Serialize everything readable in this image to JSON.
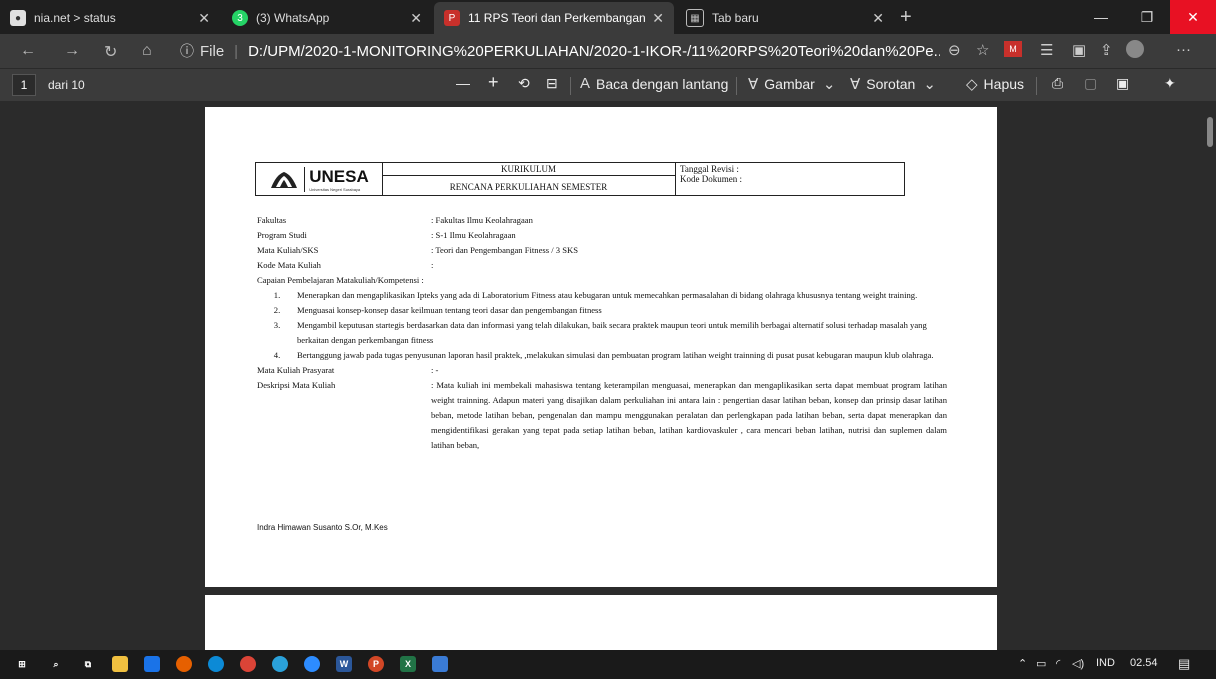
{
  "tabs": [
    {
      "label": "nia.net > status",
      "icon": "site-icon"
    },
    {
      "label": "(3) WhatsApp",
      "icon": "whatsapp-icon"
    },
    {
      "label": "11 RPS Teori dan Perkembangan",
      "icon": "pdf-icon"
    },
    {
      "label": "Tab baru",
      "icon": "newtab-page-icon"
    }
  ],
  "address": {
    "info": "ⓘ",
    "scheme": "File",
    "url": "D:/UPM/2020-1-MONITORING%20PERKULIAHAN/2020-1-IKOR-/11%20RPS%20Teori%20dan%20Pe..."
  },
  "pdf_toolbar": {
    "page": "1",
    "of": "dari 10",
    "read_aloud": "Baca dengan lantang",
    "draw": "Gambar",
    "highlight": "Sorotan",
    "erase": "Hapus"
  },
  "doc": {
    "brand": "UNESA",
    "brand_sub": "Universitas Negeri Surabaya",
    "kurikulum": "KURIKULUM",
    "rps": "RENCANA PERKULIAHAN SEMESTER",
    "tanggal": "Tanggal Revisi   :",
    "kode_dok": "Kode Dokumen   :",
    "fields": [
      {
        "k": "Fakultas",
        "v": ": Fakultas Ilmu Keolahragaan"
      },
      {
        "k": "Program Studi",
        "v": ": S-1 Ilmu Keolahragaan"
      },
      {
        "k": "Mata Kuliah/SKS",
        "v": ": Teori dan Pengembangan Fitness / 3 SKS"
      },
      {
        "k": "Kode Mata Kuliah",
        "v": ":"
      }
    ],
    "capaian": "Capaian Pembelajaran Matakuliah/Kompetensi      :",
    "items": [
      {
        "n": "1.",
        "t": "Menerapkan dan mengaplikasikan Ipteks yang ada di Laboratorium Fitness atau kebugaran untuk memecahkan permasalahan di bidang olahraga khususnya tentang weight training."
      },
      {
        "n": "2.",
        "t": "Menguasai konsep-konsep dasar keilmuan tentang teori dasar dan pengembangan fitness"
      },
      {
        "n": "3.",
        "t": "Mengambil  keputusan  startegis berdasarkan data dan informasi yang telah dilakukan, baik secara praktek maupun teori untuk memilih berbagai alternatif solusi terhadap masalah yang berkaitan dengan perkembangan fitness"
      },
      {
        "n": "4.",
        "t": "Bertanggung jawab pada tugas penyusunan laporan hasil praktek, ,melakukan simulasi dan pembuatan program latihan weight trainning di pusat pusat kebugaran maupun klub olahraga."
      }
    ],
    "prasyarat_k": "Mata Kuliah Prasyarat",
    "prasyarat_v": ": -",
    "deskripsi_k": "Deskripsi Mata Kuliah",
    "deskripsi_v": ": Mata kuliah  ini membekali  mahasiswa tentang  keterampilan menguasai, menerapkan dan mengaplikasikan serta dapat membuat program latihan weight trainning. Adapun materi yang disajikan dalam perkuliahan ini antara lain : pengertian dasar latihan beban, konsep dan prinsip dasar latihan beban, metode latihan beban, pengenalan dan mampu menggunakan peralatan dan perlengkapan  pada latihan beban, serta dapat menerapkan dan mengidentifikasi gerakan yang tepat pada setiap latihan beban, latihan kardiovaskuler , cara mencari beban latihan, nutrisi dan suplemen dalam latihan beban,",
    "signer": "Indra Himawan Susanto S.Or, M.Kes"
  },
  "tray": {
    "lang": "IND",
    "time": "02.54"
  }
}
